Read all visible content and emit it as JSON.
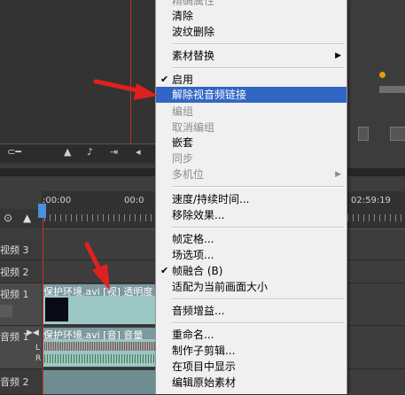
{
  "monitor": {
    "toolbar_icons": [
      "mountain-icon",
      "speaker-icon",
      "export-icon",
      "left-arrow-icon"
    ]
  },
  "timeline": {
    "timecodes": {
      "start": ":00:00",
      "mid": "00:0",
      "end": "02:59:19"
    },
    "tracks": [
      {
        "label": "视频 3"
      },
      {
        "label": "视频 2"
      },
      {
        "label": "视频 1"
      },
      {
        "label": "音频 1"
      },
      {
        "label": "音频 2"
      }
    ],
    "video_clip_title": "保护环境.avi [视] 透明度",
    "audio_clip_title": "保护环境.avi [音] 音量"
  },
  "menu": {
    "items": [
      {
        "label": "精确属性",
        "disabled": true
      },
      {
        "label": "清除",
        "disabled": false
      },
      {
        "label": "波纹删除",
        "disabled": false
      },
      {
        "label": "素材替换",
        "disabled": false,
        "submenu": true
      },
      {
        "label": "启用",
        "disabled": false,
        "checked": true
      },
      {
        "label": "解除视音频链接",
        "disabled": false,
        "highlighted": true
      },
      {
        "label": "编组",
        "disabled": true
      },
      {
        "label": "取消编组",
        "disabled": true
      },
      {
        "label": "嵌套",
        "disabled": false
      },
      {
        "label": "同步",
        "disabled": true
      },
      {
        "label": "多机位",
        "disabled": true,
        "submenu": true
      },
      {
        "label": "速度/持续时间...",
        "disabled": false
      },
      {
        "label": "移除效果...",
        "disabled": false
      },
      {
        "label": "帧定格...",
        "disabled": false
      },
      {
        "label": "场选项...",
        "disabled": false
      },
      {
        "label": "帧融合 (B)",
        "disabled": false,
        "checked": true
      },
      {
        "label": "适配为当前画面大小",
        "disabled": false
      },
      {
        "label": "音频增益...",
        "disabled": false
      },
      {
        "label": "重命名...",
        "disabled": false
      },
      {
        "label": "制作子剪辑...",
        "disabled": false
      },
      {
        "label": "在项目中显示",
        "disabled": false
      },
      {
        "label": "编辑原始素材",
        "disabled": false
      }
    ]
  },
  "colors": {
    "highlight": "#3166c5",
    "annotation": "#e02020",
    "clip": "#9bc7c4"
  }
}
